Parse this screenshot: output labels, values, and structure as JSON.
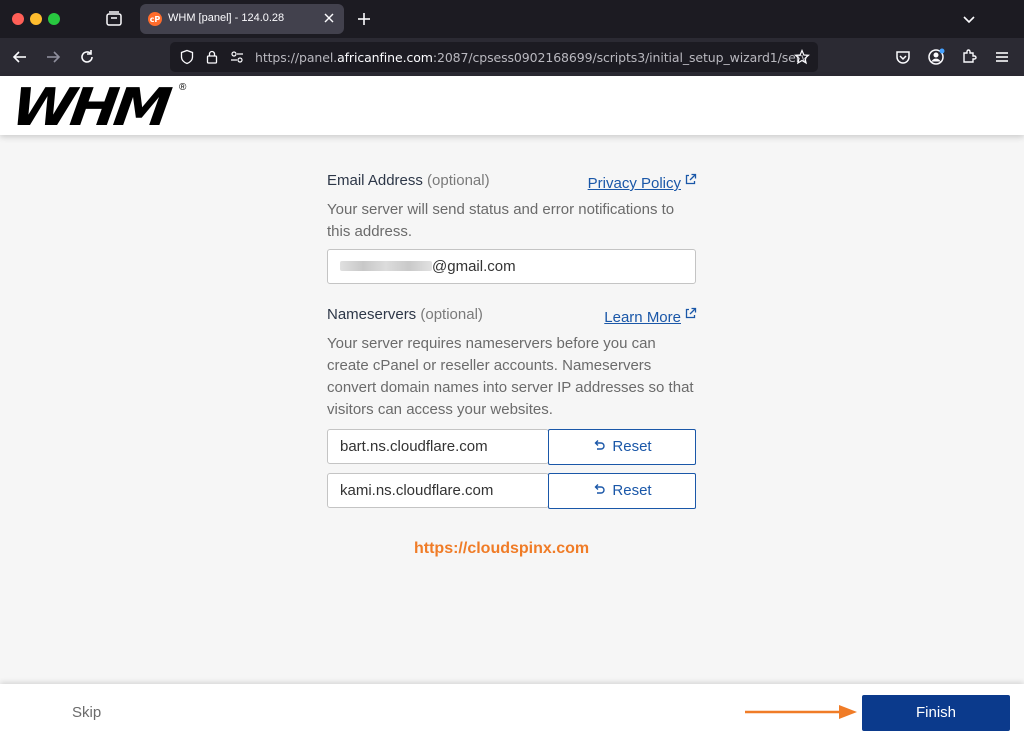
{
  "browser": {
    "tab_title": "WHM [panel] - 124.0.28",
    "url_prefix": "https://panel.",
    "url_domain": "africanfine.com",
    "url_suffix": ":2087/cpsess0902168699/scripts3/initial_setup_wizard1/serv"
  },
  "header": {
    "logo_text": "WHM",
    "logo_mark": "®"
  },
  "email": {
    "title": "Email Address",
    "optional": "(optional)",
    "link": "Privacy Policy",
    "description": "Your server will send status and error notifications to this address.",
    "value_suffix": "@gmail.com"
  },
  "nameservers": {
    "title": "Nameservers",
    "optional": "(optional)",
    "link": "Learn More",
    "description": "Your server requires nameservers before you can create cPanel or reseller accounts. Nameservers convert domain names into server IP addresses so that visitors can access your websites.",
    "items": [
      {
        "value": "bart.ns.cloudflare.com",
        "reset_label": "Reset"
      },
      {
        "value": "kami.ns.cloudflare.com",
        "reset_label": "Reset"
      }
    ]
  },
  "watermark": "https://cloudspinx.com",
  "footer": {
    "skip_label": "Skip",
    "finish_label": "Finish"
  },
  "colors": {
    "accent": "#1a57a8",
    "finish_bg": "#0b3a8c",
    "watermark": "#f07c27",
    "arrow": "#f07c27"
  }
}
